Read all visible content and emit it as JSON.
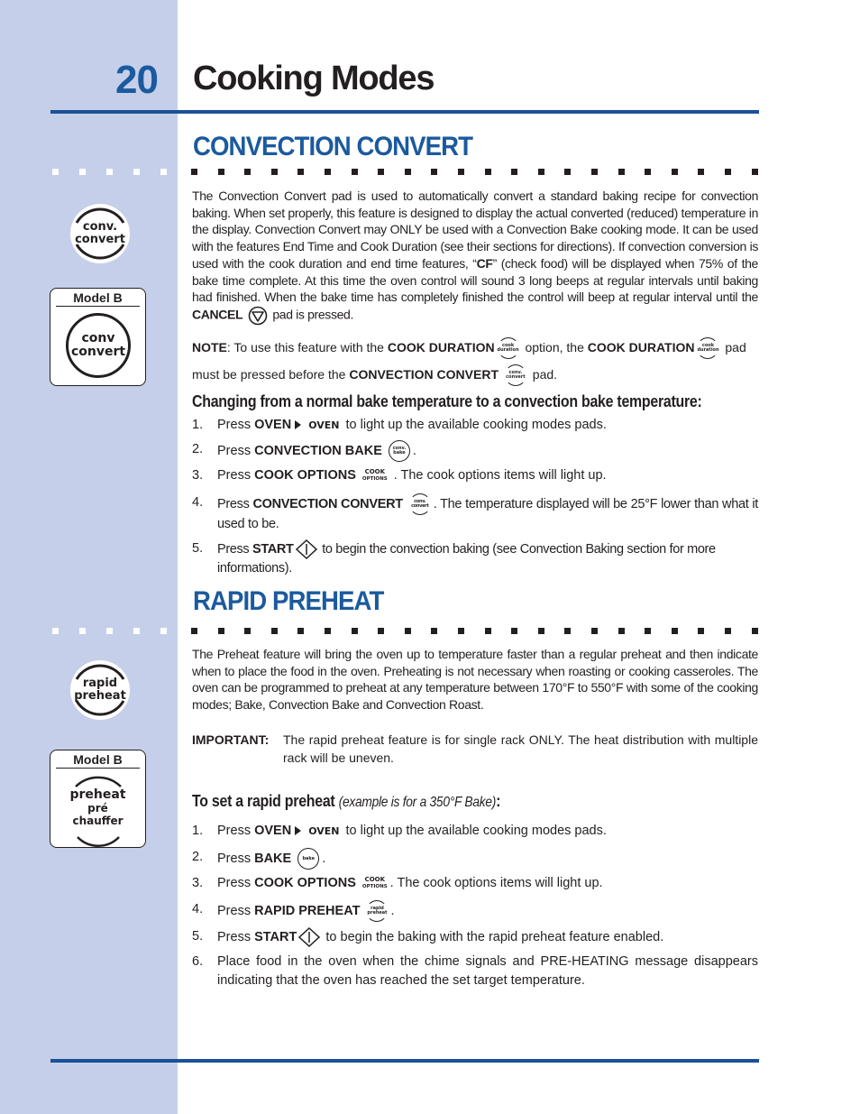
{
  "page": {
    "number": "20",
    "title": "Cooking Modes",
    "colors": {
      "side_band": "#c5cfe9",
      "accent_blue": "#1b5a9e",
      "rule_blue": "#1b5196",
      "text": "#231f20"
    }
  },
  "convection_convert": {
    "title": "CONVECTION CONVERT",
    "icon": {
      "name": "conv-convert-pad-icon",
      "line1": "conv.",
      "line2": "convert"
    },
    "model_b": {
      "label": "Model B",
      "line1": "conv",
      "line2": "convert"
    },
    "intro": {
      "text": "The Convection Convert pad is used to automatically convert a standard baking recipe for convection baking. When set properly, this feature is designed to display the actual converted (reduced) temperature in the display. Convection Convert may ONLY be used with a Convection Bake cooking mode. It can be used with the features End Time and Cook Duration (see their sections for directions). If convection conversion is used with the cook duration and end time features, “",
      "cf": "CF",
      "text2": "” (check food) will be displayed when 75% of the bake time complete. At this time the oven control will sound 3 long beeps at regular intervals until baking had finished. When the bake time has completely finished the control will beep at regular interval until the ",
      "cancel": "CANCEL",
      "text3": " pad is pressed."
    },
    "note": {
      "label": "NOTE",
      "t1": ": To use this feature with the ",
      "cook_duration": "COOK DURATION",
      "t2": " option, the ",
      "t3": " pad must be pressed before the ",
      "conv_convert": "CONVECTION CONVERT",
      "t4": " pad.",
      "cook_duration_icon": {
        "line1": "cook",
        "line2": "duration"
      },
      "conv_convert_icon": {
        "line1": "conv.",
        "line2": "convert"
      }
    },
    "subheading": "Changing from a normal bake temperature to a convection bake temperature:",
    "steps": [
      {
        "num": "1.",
        "pre": "Press ",
        "bold": "OVEN",
        "icon_text": "OVEN",
        "post": " to light up the available cooking modes pads."
      },
      {
        "num": "2.",
        "pre": "Press ",
        "bold": "CONVECTION BAKE",
        "icon": {
          "line1": "conv.",
          "line2": "bake"
        },
        "post": "."
      },
      {
        "num": "3.",
        "pre": "Press ",
        "bold": "COOK OPTIONS",
        "icon": {
          "line1": "COOK",
          "line2": "OPTIONS"
        },
        "post": " . The cook options items will light up."
      },
      {
        "num": "4.",
        "pre": "Press ",
        "bold": "CONVECTION CONVERT",
        "icon": {
          "line1": "conv.",
          "line2": "convert"
        },
        "post": ". The temperature displayed will be 25°F lower than what it used to be."
      },
      {
        "num": "5.",
        "pre": "Press ",
        "bold": "START",
        "post": " to begin the convection baking (see Convection Baking section for more informations)."
      }
    ]
  },
  "rapid_preheat": {
    "title": "RAPID PREHEAT",
    "icon": {
      "line1": "rapid",
      "line2": "preheat"
    },
    "model_b": {
      "label": "Model B",
      "line1": "preheat",
      "line2": "pré",
      "line3": "chauffer"
    },
    "intro": "The Preheat feature will bring the oven up to temperature faster than a regular preheat and then indicate when to place the food in the oven. Preheating is not necessary when roasting or cooking casseroles. The oven can be programmed to preheat at any temperature between 170°F to 550°F with some of the cooking modes; Bake, Convection Bake and Convection Roast.",
    "important": {
      "label": "IMPORTANT:",
      "text": "The rapid preheat feature is for single rack ONLY. The heat distribution with multiple rack will be uneven."
    },
    "subheading": {
      "main": "To set a rapid preheat ",
      "example": "(example is for a 350°F Bake)",
      "colon": ":"
    },
    "steps": [
      {
        "num": "1.",
        "pre": "Press ",
        "bold": "OVEN",
        "icon_text": "OVEN",
        "post": " to light up the available cooking modes pads."
      },
      {
        "num": "2.",
        "pre": "Press ",
        "bold": "BAKE",
        "icon": {
          "line1": "bake"
        },
        "post": "."
      },
      {
        "num": "3.",
        "pre": "Press ",
        "bold": "COOK OPTIONS",
        "icon": {
          "line1": "COOK",
          "line2": "OPTIONS"
        },
        "post": ". The cook options items will light up."
      },
      {
        "num": "4.",
        "pre": "Press ",
        "bold": "RAPID PREHEAT",
        "icon": {
          "line1": "rapid",
          "line2": "preheat"
        },
        "post": "."
      },
      {
        "num": "5.",
        "pre": "Press ",
        "bold": "START",
        "post": " to begin the baking with the rapid preheat feature enabled."
      },
      {
        "num": "6.",
        "pre": "Place food in the oven when the chime signals and PRE-HEATING message disappears indicating that the oven has reached the set target temperature."
      }
    ]
  }
}
